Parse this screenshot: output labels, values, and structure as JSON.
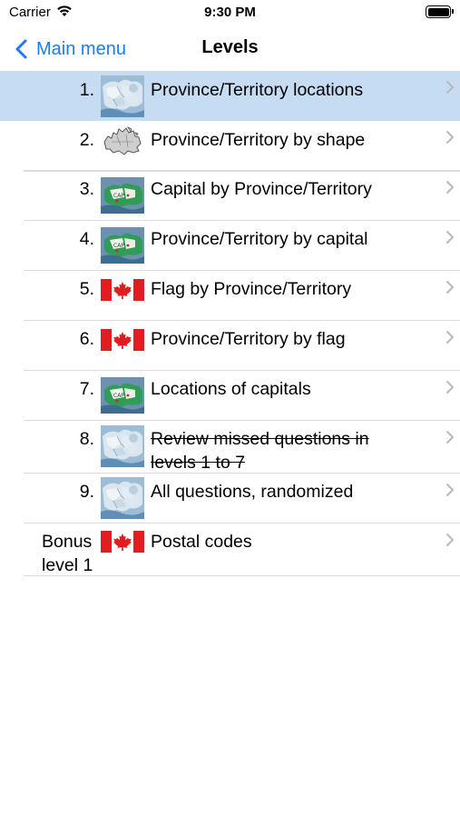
{
  "status_bar": {
    "carrier": "Carrier",
    "time": "9:30 PM"
  },
  "nav": {
    "back_label": "Main menu",
    "title": "Levels"
  },
  "colors": {
    "accent": "#1a7cf5",
    "selected_row": "#c6dcf2",
    "flag_red": "#e01d20"
  },
  "levels": [
    {
      "number": "1.",
      "title": "Province/Territory locations",
      "icon": "map-locations-icon",
      "selected": true
    },
    {
      "number": "2.",
      "title": "Province/Territory by shape",
      "icon": "canada-outline-icon"
    },
    {
      "number": "3.",
      "title": "Capital by Province/Territory",
      "icon": "map-capital-icon"
    },
    {
      "number": "4.",
      "title": "Province/Territory by capital",
      "icon": "map-capital-icon"
    },
    {
      "number": "5.",
      "title": "Flag by Province/Territory",
      "icon": "canada-flag-icon"
    },
    {
      "number": "6.",
      "title": "Province/Territory by flag",
      "icon": "canada-flag-icon"
    },
    {
      "number": "7.",
      "title": "Locations of capitals",
      "icon": "map-capital-icon"
    },
    {
      "number": "8.",
      "title": "Review missed questions in levels 1 to 7",
      "title_line1": "Review missed questions in",
      "title_line2": "levels 1 to 7",
      "icon": "map-locations-icon",
      "struck": true
    },
    {
      "number": "9.",
      "title": "All questions, randomized",
      "icon": "map-locations-icon"
    },
    {
      "number_line1": "Bonus",
      "number_line2": "level 1",
      "title": "Postal codes",
      "icon": "canada-flag-icon"
    }
  ]
}
